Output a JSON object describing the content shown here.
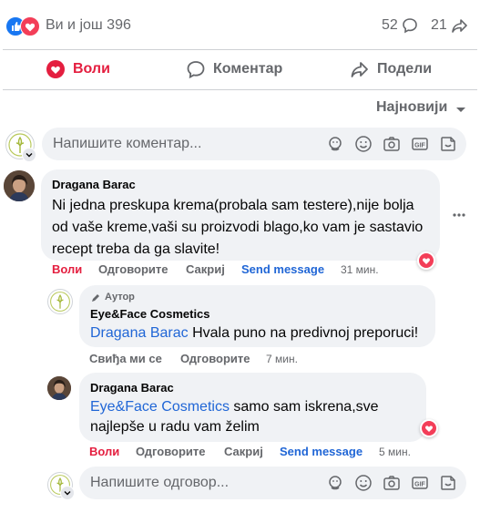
{
  "reactions": {
    "summary": "Ви и још 396",
    "comments_count": "52",
    "shares_count": "21"
  },
  "actions": {
    "like": "Воли",
    "comment": "Коментар",
    "share": "Подели"
  },
  "sort": {
    "label": "Најновији"
  },
  "comment_box": {
    "placeholder": "Напишите коментар..."
  },
  "comment1": {
    "author": "Dragana Barac",
    "text": "Ni jedna preskupa krema(probala sam testere),nije bolja od vaše kreme,vaši su proizvodi blago,ko vam je sastavio recept treba da ga slavite!",
    "like": "Воли",
    "reply": "Одговорите",
    "hide": "Сакриј",
    "send": "Send message",
    "time": "31 мин."
  },
  "reply1": {
    "badge": "Аутор",
    "author": "Eye&Face Cosmetics",
    "mention": "Dragana Barac",
    "text": " Hvala puno na predivnoj preporuci!",
    "like": "Свиђа ми се",
    "reply": "Одговорите",
    "time": "7 мин."
  },
  "reply2": {
    "author": "Dragana Barac",
    "mention": "Eye&Face Cosmetics",
    "text": " samo sam iskrena,sve najlepše u radu vam želim",
    "like": "Воли",
    "reply": "Одговорите",
    "hide": "Сакриј",
    "send": "Send message",
    "time": "5 мин."
  },
  "reply_box": {
    "placeholder": "Напишите одговор..."
  },
  "colors": {
    "like_blue": "#1877f2",
    "love_red": "#f33e58",
    "link_blue": "#2066d6",
    "bubble": "#f0f2f5"
  },
  "icons": [
    "like-icon",
    "love-icon",
    "comment-icon",
    "share-icon",
    "heart-icon",
    "speech-bubble-icon",
    "share-arrow-icon",
    "chevron-down-icon",
    "avatar-sticker-icon",
    "emoji-icon",
    "camera-icon",
    "gif-icon",
    "sticker-icon",
    "more-icon",
    "pencil-icon"
  ]
}
